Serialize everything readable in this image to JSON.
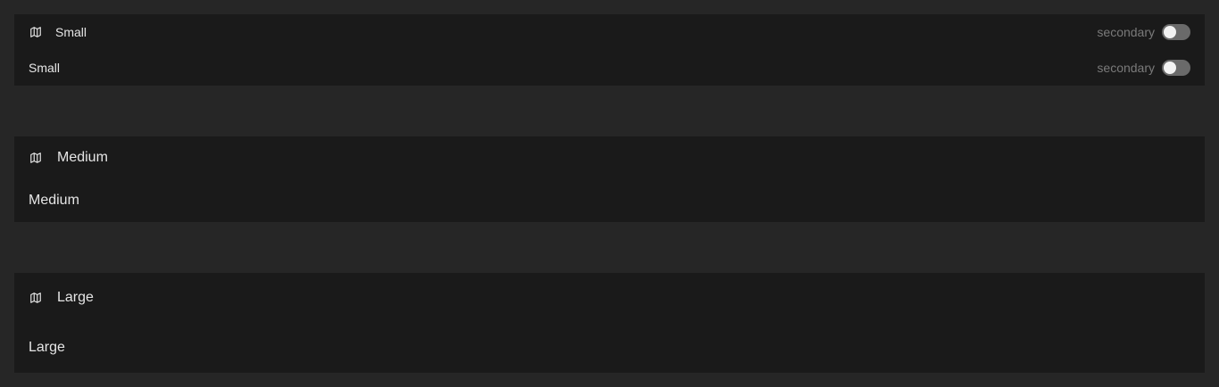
{
  "small": {
    "row1": {
      "icon": "map-icon",
      "label": "Small",
      "secondary": "secondary",
      "toggle_on": false
    },
    "row2": {
      "label": "Small",
      "secondary": "secondary",
      "toggle_on": false
    }
  },
  "medium": {
    "row1": {
      "icon": "map-icon",
      "label": "Medium"
    },
    "row2": {
      "label": "Medium"
    }
  },
  "large": {
    "row1": {
      "icon": "map-icon",
      "label": "Large"
    },
    "row2": {
      "label": "Large"
    }
  },
  "colors": {
    "background": "#262626",
    "panel": "#1a1a1a",
    "text": "#e6e6e6",
    "secondary_text": "#7a7a7a",
    "toggle_track": "#6a6a6a",
    "toggle_knob": "#f2f2f2"
  }
}
